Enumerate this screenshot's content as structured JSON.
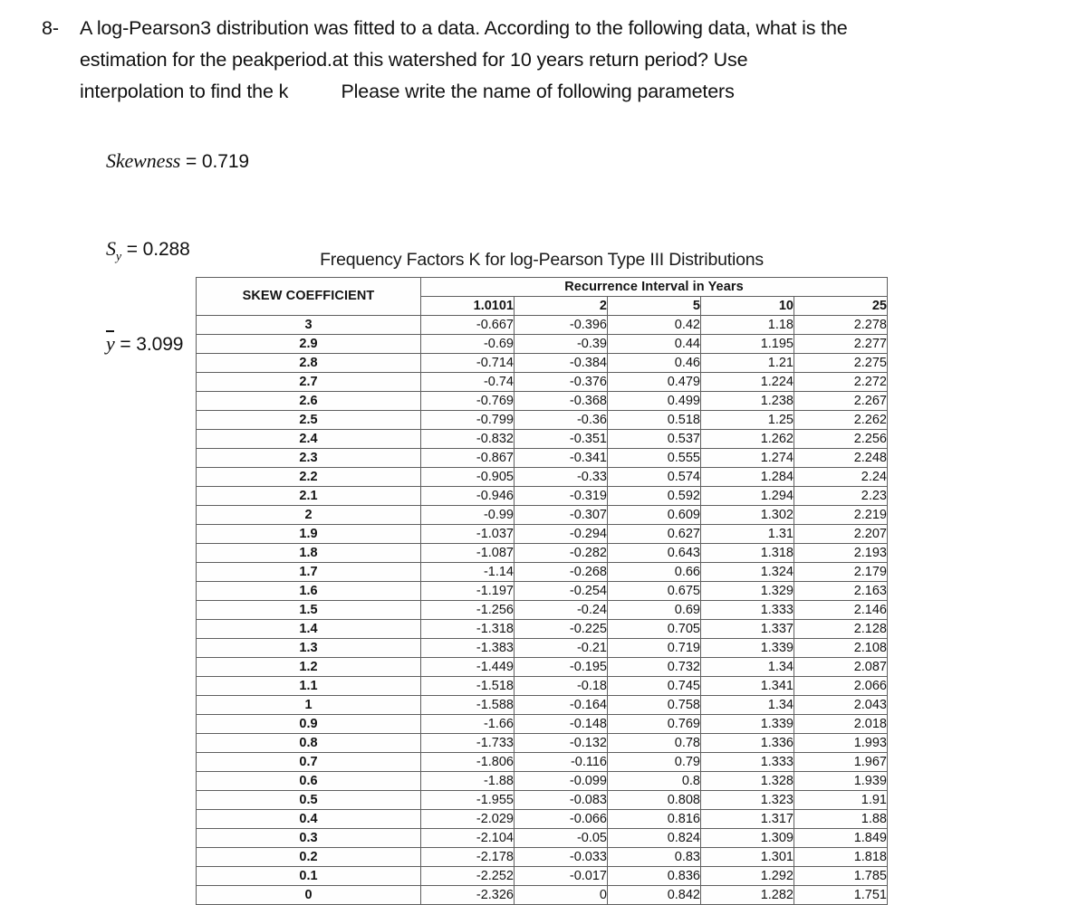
{
  "question": {
    "number": "8-",
    "lines": [
      "A log-Pearson3 distribution was fitted to a data. According to the following data, what is the",
      "estimation for the peakperiod.at this watershed for 10 years return period? Use",
      "interpolation to find the k          Please write the name of following parameters"
    ]
  },
  "parameters": [
    {
      "symbol": "Skewness",
      "sub": "",
      "equals": "=",
      "value": "0.719"
    },
    {
      "symbol": "S",
      "sub": "y",
      "equals": "=",
      "value": "0.288"
    },
    {
      "symbol": "y",
      "sub": "",
      "equals": "=",
      "value": "3.099",
      "overbar": true
    }
  ],
  "param_text": {
    "skewness_line": "Skewness = 0.719",
    "sy_line": "Sy = 0.288",
    "ybar_line": "y = 3.099"
  },
  "table": {
    "title": "Frequency Factors K for log-Pearson Type III Distributions",
    "skew_header": "SKEW COEFFICIENT",
    "recurrence_header": "Recurrence Interval in Years",
    "interval_headers": [
      "1.0101",
      "2",
      "5",
      "10",
      "25"
    ],
    "rows": [
      {
        "skew": "3",
        "values": [
          "-0.667",
          "-0.396",
          "0.42",
          "1.18",
          "2.278"
        ]
      },
      {
        "skew": "2.9",
        "values": [
          "-0.69",
          "-0.39",
          "0.44",
          "1.195",
          "2.277"
        ]
      },
      {
        "skew": "2.8",
        "values": [
          "-0.714",
          "-0.384",
          "0.46",
          "1.21",
          "2.275"
        ]
      },
      {
        "skew": "2.7",
        "values": [
          "-0.74",
          "-0.376",
          "0.479",
          "1.224",
          "2.272"
        ]
      },
      {
        "skew": "2.6",
        "values": [
          "-0.769",
          "-0.368",
          "0.499",
          "1.238",
          "2.267"
        ]
      },
      {
        "skew": "2.5",
        "values": [
          "-0.799",
          "-0.36",
          "0.518",
          "1.25",
          "2.262"
        ]
      },
      {
        "skew": "2.4",
        "values": [
          "-0.832",
          "-0.351",
          "0.537",
          "1.262",
          "2.256"
        ]
      },
      {
        "skew": "2.3",
        "values": [
          "-0.867",
          "-0.341",
          "0.555",
          "1.274",
          "2.248"
        ]
      },
      {
        "skew": "2.2",
        "values": [
          "-0.905",
          "-0.33",
          "0.574",
          "1.284",
          "2.24"
        ]
      },
      {
        "skew": "2.1",
        "values": [
          "-0.946",
          "-0.319",
          "0.592",
          "1.294",
          "2.23"
        ]
      },
      {
        "skew": "2",
        "values": [
          "-0.99",
          "-0.307",
          "0.609",
          "1.302",
          "2.219"
        ]
      },
      {
        "skew": "1.9",
        "values": [
          "-1.037",
          "-0.294",
          "0.627",
          "1.31",
          "2.207"
        ]
      },
      {
        "skew": "1.8",
        "values": [
          "-1.087",
          "-0.282",
          "0.643",
          "1.318",
          "2.193"
        ]
      },
      {
        "skew": "1.7",
        "values": [
          "-1.14",
          "-0.268",
          "0.66",
          "1.324",
          "2.179"
        ]
      },
      {
        "skew": "1.6",
        "values": [
          "-1.197",
          "-0.254",
          "0.675",
          "1.329",
          "2.163"
        ]
      },
      {
        "skew": "1.5",
        "values": [
          "-1.256",
          "-0.24",
          "0.69",
          "1.333",
          "2.146"
        ]
      },
      {
        "skew": "1.4",
        "values": [
          "-1.318",
          "-0.225",
          "0.705",
          "1.337",
          "2.128"
        ]
      },
      {
        "skew": "1.3",
        "values": [
          "-1.383",
          "-0.21",
          "0.719",
          "1.339",
          "2.108"
        ]
      },
      {
        "skew": "1.2",
        "values": [
          "-1.449",
          "-0.195",
          "0.732",
          "1.34",
          "2.087"
        ]
      },
      {
        "skew": "1.1",
        "values": [
          "-1.518",
          "-0.18",
          "0.745",
          "1.341",
          "2.066"
        ]
      },
      {
        "skew": "1",
        "values": [
          "-1.588",
          "-0.164",
          "0.758",
          "1.34",
          "2.043"
        ]
      },
      {
        "skew": "0.9",
        "values": [
          "-1.66",
          "-0.148",
          "0.769",
          "1.339",
          "2.018"
        ]
      },
      {
        "skew": "0.8",
        "values": [
          "-1.733",
          "-0.132",
          "0.78",
          "1.336",
          "1.993"
        ]
      },
      {
        "skew": "0.7",
        "values": [
          "-1.806",
          "-0.116",
          "0.79",
          "1.333",
          "1.967"
        ]
      },
      {
        "skew": "0.6",
        "values": [
          "-1.88",
          "-0.099",
          "0.8",
          "1.328",
          "1.939"
        ]
      },
      {
        "skew": "0.5",
        "values": [
          "-1.955",
          "-0.083",
          "0.808",
          "1.323",
          "1.91"
        ]
      },
      {
        "skew": "0.4",
        "values": [
          "-2.029",
          "-0.066",
          "0.816",
          "1.317",
          "1.88"
        ]
      },
      {
        "skew": "0.3",
        "values": [
          "-2.104",
          "-0.05",
          "0.824",
          "1.309",
          "1.849"
        ]
      },
      {
        "skew": "0.2",
        "values": [
          "-2.178",
          "-0.033",
          "0.83",
          "1.301",
          "1.818"
        ]
      },
      {
        "skew": "0.1",
        "values": [
          "-2.252",
          "-0.017",
          "0.836",
          "1.292",
          "1.785"
        ]
      },
      {
        "skew": "0",
        "values": [
          "-2.326",
          "0",
          "0.842",
          "1.282",
          "1.751"
        ]
      }
    ]
  },
  "colors": {
    "page_background": "#ffffff",
    "text": "#111111",
    "table_border": "#5f5f5f"
  }
}
